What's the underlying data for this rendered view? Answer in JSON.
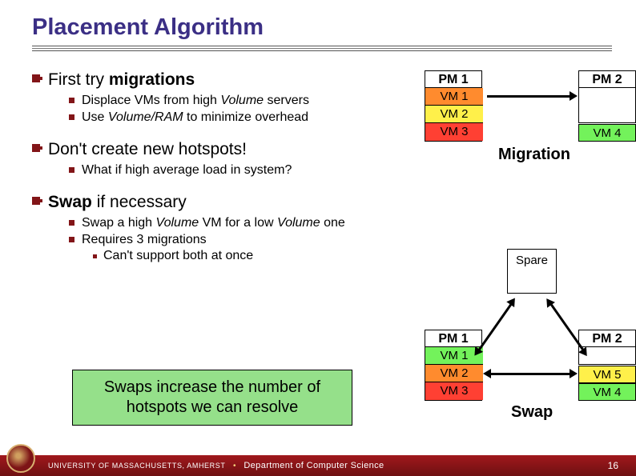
{
  "title": "Placement Algorithm",
  "bullets": {
    "b1": "First try ",
    "b1_bold": "migrations",
    "b1_sub1_a": "Displace VMs from high ",
    "b1_sub1_i": "Volume",
    "b1_sub1_b": " servers",
    "b1_sub2_a": "Use ",
    "b1_sub2_i": "Volume/RAM",
    "b1_sub2_b": " to minimize overhead",
    "b2": "Don't create new hotspots!",
    "b2_sub": "What if high average load in system?",
    "b3_bold": "Swap",
    "b3_rest": " if necessary",
    "b3_sub1_a": "Swap a high ",
    "b3_sub1_i1": "Volume",
    "b3_sub1_b": " VM for a low ",
    "b3_sub1_i2": "Volume",
    "b3_sub1_c": " one",
    "b3_sub2": "Requires 3 migrations",
    "b3_sub3": "Can't support both at once"
  },
  "callout": "Swaps increase the number of hotspots we can resolve",
  "diagram": {
    "pm1": "PM 1",
    "pm2": "PM 2",
    "vm1": "VM 1",
    "vm2": "VM 2",
    "vm3": "VM 3",
    "vm4": "VM 4",
    "vm5": "VM 5",
    "migration": "Migration",
    "spare": "Spare",
    "swap": "Swap"
  },
  "footer": {
    "uni": "UNIVERSITY OF MASSACHUSETTS, AMHERST",
    "dept": "Department of Computer Science",
    "page": "16"
  }
}
